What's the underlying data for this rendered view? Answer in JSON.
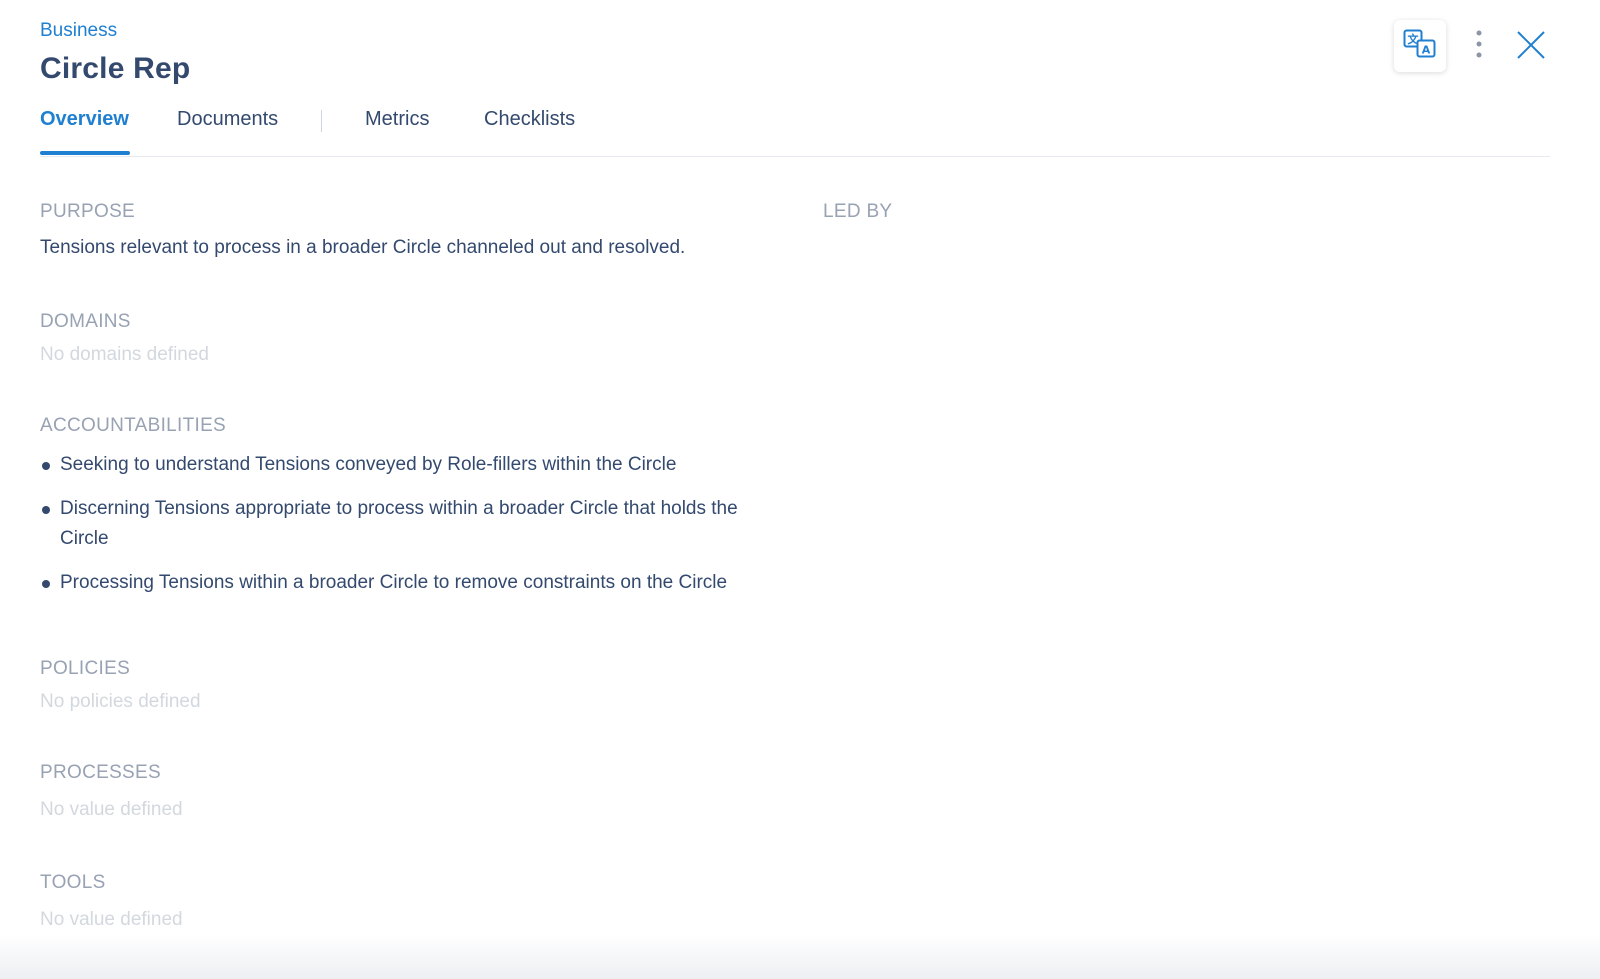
{
  "breadcrumb": "Business",
  "title": "Circle Rep",
  "tabs": [
    {
      "label": "Overview",
      "active": true
    },
    {
      "label": "Documents",
      "active": false
    },
    {
      "label": "Metrics",
      "active": false
    },
    {
      "label": "Checklists",
      "active": false
    }
  ],
  "icons": {
    "translate": "translate-icon",
    "more": "more-vertical-icon",
    "close": "close-icon"
  },
  "colors": {
    "accent": "#1f7fd1",
    "text": "#33496e",
    "label": "#98a2b3",
    "empty": "#d3d8df"
  },
  "purpose": {
    "label": "PURPOSE",
    "text": "Tensions relevant to process in a broader Circle channeled out and resolved."
  },
  "led_by": {
    "label": "LED BY"
  },
  "domains": {
    "label": "DOMAINS",
    "empty": "No domains defined"
  },
  "accountabilities": {
    "label": "ACCOUNTABILITIES",
    "items": [
      "Seeking to understand Tensions conveyed by Role-fillers within the Circle",
      "Discerning Tensions appropriate to process within a broader Circle that holds the Circle",
      "Processing Tensions within a broader Circle to remove constraints on the Circle"
    ]
  },
  "policies": {
    "label": "POLICIES",
    "empty": "No policies defined"
  },
  "processes": {
    "label": "PROCESSES",
    "empty": "No value defined"
  },
  "tools": {
    "label": "TOOLS",
    "empty": "No value defined"
  }
}
